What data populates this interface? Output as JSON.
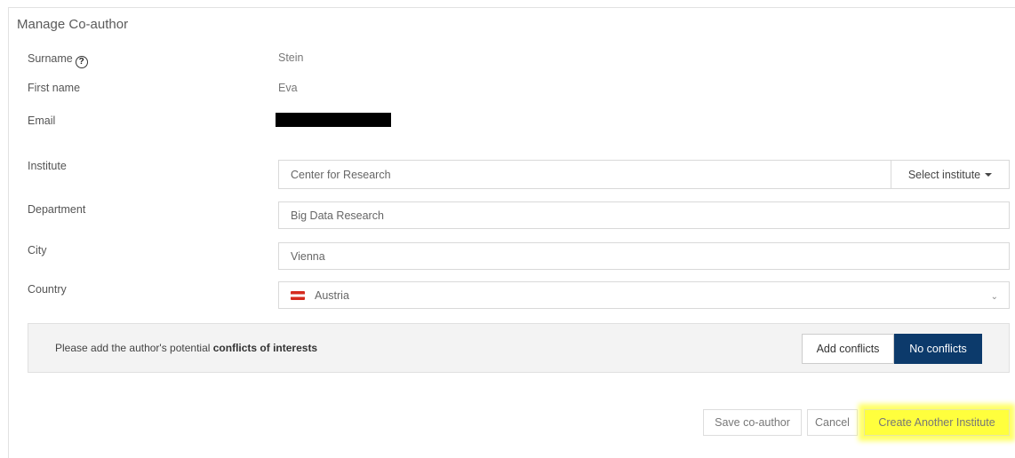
{
  "title": "Manage Co-author",
  "fields": {
    "surname_label": "Surname",
    "surname_value": "Stein",
    "firstname_label": "First name",
    "firstname_value": "Eva",
    "email_label": "Email",
    "institute_label": "Institute",
    "institute_value": "Center for Research",
    "select_institute_label": "Select institute",
    "department_label": "Department",
    "department_value": "Big Data Research",
    "city_label": "City",
    "city_value": "Vienna",
    "country_label": "Country",
    "country_value": "Austria"
  },
  "conflicts": {
    "prefix": "Please add the author's potential ",
    "emphasis": "conflicts of interests",
    "add_label": "Add conflicts",
    "none_label": "No conflicts"
  },
  "actions": {
    "save_label": "Save co-author",
    "cancel_label": "Cancel",
    "create_label": "Create Another Institute"
  },
  "icons": {
    "help": "question-circle-icon",
    "flag": "austria-flag-icon",
    "caret": "caret-down-icon",
    "chevron": "chevron-down-icon"
  },
  "colors": {
    "primary": "#0c3a6b",
    "highlight": "#ffff3d"
  }
}
